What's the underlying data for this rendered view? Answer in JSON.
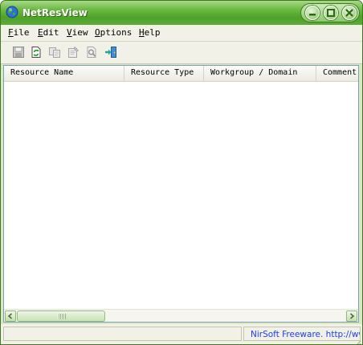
{
  "window": {
    "title": "NetResView"
  },
  "menu": {
    "items": [
      {
        "mnemonic": "F",
        "rest": "ile"
      },
      {
        "mnemonic": "E",
        "rest": "dit"
      },
      {
        "mnemonic": "V",
        "rest": "iew"
      },
      {
        "mnemonic": "O",
        "rest": "ptions"
      },
      {
        "mnemonic": "H",
        "rest": "elp"
      }
    ]
  },
  "toolbar": {
    "buttons": [
      {
        "icon": "save-icon",
        "enabled": false
      },
      {
        "icon": "refresh-icon",
        "enabled": true
      },
      {
        "icon": "copy-icon",
        "enabled": false
      },
      {
        "icon": "properties-icon",
        "enabled": false
      },
      {
        "icon": "find-icon",
        "enabled": false
      },
      {
        "icon": "exit-icon",
        "enabled": true
      }
    ]
  },
  "list": {
    "columns": [
      "Resource Name",
      "Resource Type",
      "Workgroup / Domain",
      "Comment"
    ],
    "rows": []
  },
  "status": {
    "left_text": "",
    "link_text": "NirSoft Freeware.  http://www.nirsoft.net"
  },
  "colors": {
    "title_bar": "#4ea12a",
    "link": "#1d3ee3"
  }
}
